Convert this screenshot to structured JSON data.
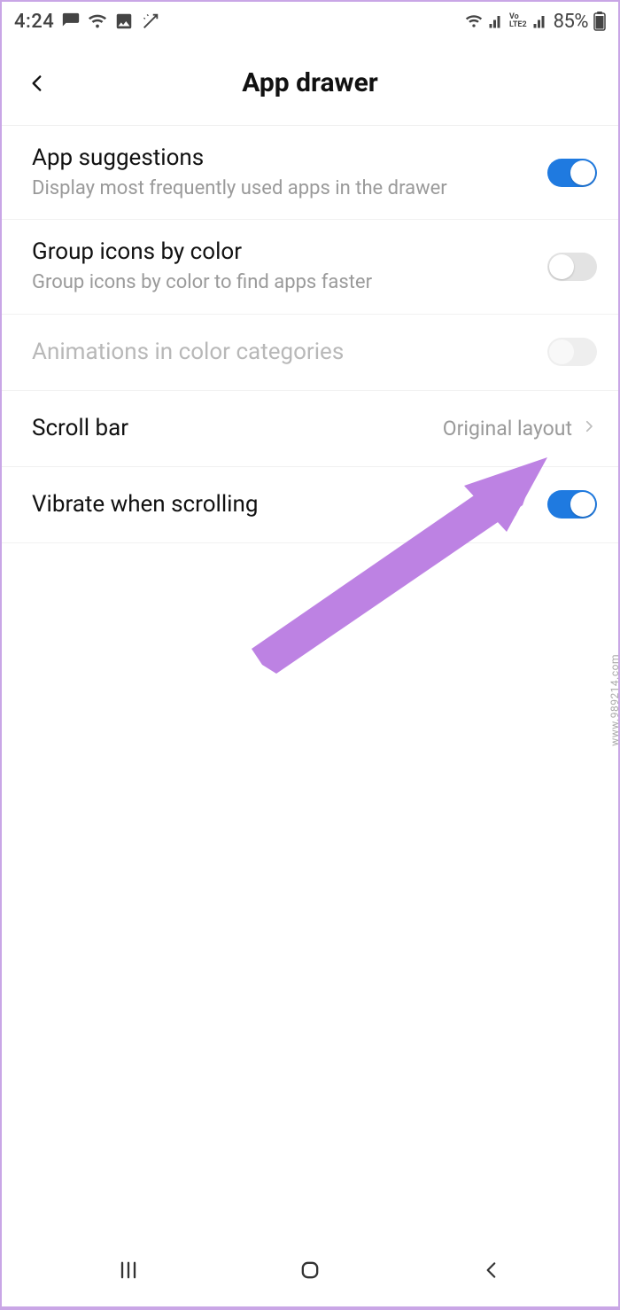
{
  "status": {
    "time": "4:24",
    "battery": "85%"
  },
  "header": {
    "title": "App drawer"
  },
  "settings": {
    "app_suggestions": {
      "title": "App suggestions",
      "subtitle": "Display most frequently used apps in the drawer",
      "enabled": true
    },
    "group_icons": {
      "title": "Group icons by color",
      "subtitle": "Group icons by color to find apps faster",
      "enabled": false
    },
    "animations": {
      "title": "Animations in color categories",
      "enabled": false,
      "row_disabled": true
    },
    "scroll_bar": {
      "title": "Scroll bar",
      "value": "Original layout"
    },
    "vibrate": {
      "title": "Vibrate when scrolling",
      "enabled": true
    }
  },
  "watermark": "www.989214.com"
}
